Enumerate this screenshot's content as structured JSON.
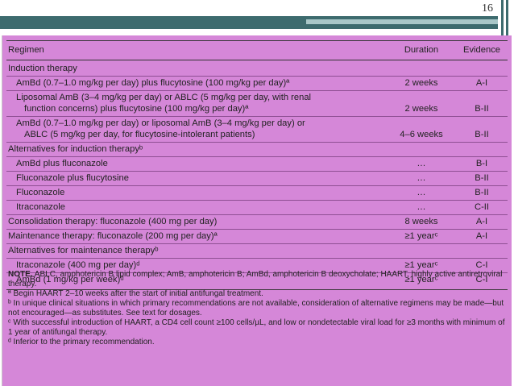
{
  "slide": {
    "page_number": "16"
  },
  "table": {
    "headers": {
      "regimen": "Regimen",
      "duration": "Duration",
      "evidence": "Evidence"
    },
    "rows": [
      {
        "regimen": "Induction therapy",
        "duration": "",
        "evidence": ""
      },
      {
        "regimen": "AmBd (0.7–1.0 mg/kg per day) plus flucytosine (100 mg/kg per day)ª",
        "duration": "2 weeks",
        "evidence": "A-I"
      },
      {
        "regimen": "Liposomal AmB (3–4 mg/kg per day) or ABLC (5 mg/kg per day, with renal",
        "regimen2": "function concerns) plus flucytosine (100 mg/kg per day)ª",
        "duration": "2 weeks",
        "evidence": "B-II"
      },
      {
        "regimen": "AmBd (0.7–1.0 mg/kg per day) or liposomal AmB (3–4 mg/kg per day) or",
        "regimen2": "ABLC (5 mg/kg per day, for flucytosine-intolerant patients)",
        "duration": "4–6 weeks",
        "evidence": "B-II"
      },
      {
        "regimen": "Alternatives for induction therapyᵇ",
        "duration": "",
        "evidence": ""
      },
      {
        "regimen": "AmBd plus fluconazole",
        "duration": "…",
        "evidence": "B-I"
      },
      {
        "regimen": "Fluconazole plus flucytosine",
        "duration": "…",
        "evidence": "B-II"
      },
      {
        "regimen": "Fluconazole",
        "duration": "…",
        "evidence": "B-II"
      },
      {
        "regimen": "Itraconazole",
        "duration": "…",
        "evidence": "C-II"
      },
      {
        "regimen": "Consolidation therapy: fluconazole (400 mg per day)",
        "duration": "8 weeks",
        "evidence": "A-I"
      },
      {
        "regimen": "Maintenance therapy: fluconazole (200 mg per day)ª",
        "duration": "≥1 yearᶜ",
        "evidence": "A-I"
      },
      {
        "regimen": "Alternatives for maintenance therapyᵇ",
        "duration": "",
        "evidence": ""
      },
      {
        "regimen": "Itraconazole (400 mg per day)ᵈ",
        "duration": "≥1 yearᶜ",
        "evidence": "C-I"
      },
      {
        "regimen": "AmBd (1 mg/kg per week)ᵈ",
        "duration": "≥1 yearᶜ",
        "evidence": "C-I"
      }
    ]
  },
  "notes": {
    "note_label": "NOTE.",
    "note_text": "ABLC, amphotericin B lipid complex; AmB, amphotericin B; AmBd, amphotericin B deoxycholate; HAART, highly active antiretroviral therapy.",
    "a": "ª Begin HAART 2–10 weeks after the start of initial antifungal treatment.",
    "b": "ᵇ In unique clinical situations in which primary recommendations are not available, consideration of alternative regimens may be made—but not encouraged—as substitutes. See text for dosages.",
    "c": "ᶜ With successful introduction of HAART, a CD4 cell count ≥100 cells/µL, and low or nondetectable viral load for ≥3 months with minimum of 1 year of antifungal therapy.",
    "d": "ᵈ Inferior to the primary recommendation."
  }
}
